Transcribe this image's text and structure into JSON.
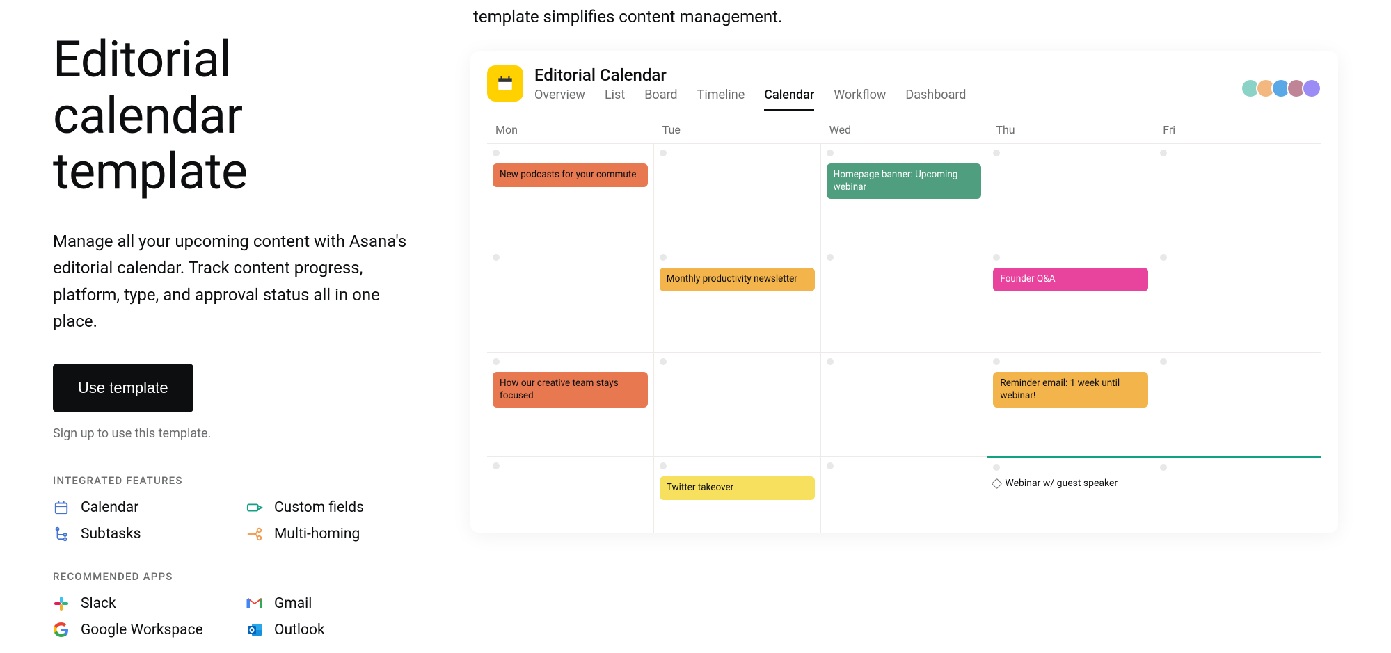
{
  "left": {
    "title": "Editorial calendar template",
    "description": "Manage all your upcoming content with Asana's editorial calendar. Track content progress, platform, type, and approval status all in one place.",
    "cta_label": "Use template",
    "signup_note": "Sign up to use this template.",
    "features_label": "INTEGRATED FEATURES",
    "features": [
      {
        "label": "Calendar",
        "icon": "calendar-icon",
        "color": "#4573d2"
      },
      {
        "label": "Custom fields",
        "icon": "custom-fields-icon",
        "color": "#14a085"
      },
      {
        "label": "Subtasks",
        "icon": "subtasks-icon",
        "color": "#4573d2"
      },
      {
        "label": "Multi-homing",
        "icon": "multi-homing-icon",
        "color": "#f2994a"
      }
    ],
    "apps_label": "RECOMMENDED APPS",
    "apps": [
      {
        "label": "Slack",
        "icon": "slack-icon"
      },
      {
        "label": "Gmail",
        "icon": "gmail-icon"
      },
      {
        "label": "Google Workspace",
        "icon": "google-icon"
      },
      {
        "label": "Outlook",
        "icon": "outlook-icon"
      }
    ]
  },
  "right": {
    "top_blurb": "template simplifies content management.",
    "project_title": "Editorial Calendar",
    "tabs": [
      "Overview",
      "List",
      "Board",
      "Timeline",
      "Calendar",
      "Workflow",
      "Dashboard"
    ],
    "active_tab": "Calendar",
    "avatar_colors": [
      "#8bd3c7",
      "#f2b880",
      "#5aa9e6",
      "#c08497",
      "#9b8bf4"
    ],
    "day_headers": [
      "Mon",
      "Tue",
      "Wed",
      "Thu",
      "Fri"
    ],
    "weeks": [
      [
        {
          "event": {
            "text": "New podcasts for your commute",
            "color": "#e8784f"
          }
        },
        {},
        {
          "event": {
            "text": "Homepage banner: Upcoming webinar",
            "color": "#4f9e7f",
            "light_text": true
          }
        },
        {},
        {}
      ],
      [
        {},
        {
          "event": {
            "text": "Monthly productivity newsletter",
            "color": "#f2b44b"
          }
        },
        {},
        {
          "event": {
            "text": "Founder Q&A",
            "color": "#e8439d",
            "light_text": true
          }
        },
        {}
      ],
      [
        {
          "event": {
            "text": "How our creative team stays focused",
            "color": "#e8784f"
          }
        },
        {},
        {},
        {
          "event": {
            "text": "Reminder email: 1 week until webinar!",
            "color": "#f2b44b"
          }
        },
        {}
      ],
      [
        {},
        {
          "event": {
            "text": "Twitter takeover",
            "color": "#f6e05e"
          }
        },
        {},
        {
          "special": {
            "text": "Webinar w/ guest speaker"
          }
        },
        {}
      ]
    ]
  }
}
